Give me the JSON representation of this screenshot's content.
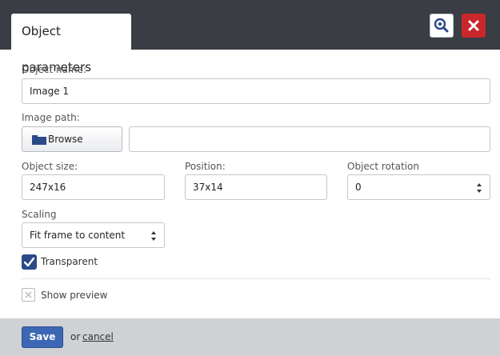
{
  "dialog": {
    "tab_title": "Object parameters",
    "zoom_button": "search-icon",
    "close_button": "close-icon"
  },
  "form": {
    "object_name_label": "Object name:",
    "object_name_value": "Image 1",
    "image_path_label": "Image path:",
    "browse_label": "Browse",
    "image_path_value": "",
    "object_size_label": "Object size:",
    "object_size_value": "247x16",
    "position_label": "Position:",
    "position_value": "37x14",
    "rotation_label": "Object rotation",
    "rotation_value": "0",
    "scaling_label": "Scaling",
    "scaling_value": "Fit frame to content",
    "transparent_label": "Transparent",
    "transparent_checked": true,
    "show_preview_label": "Show preview",
    "show_preview_checked": false
  },
  "footer": {
    "save_label": "Save",
    "or_text": "or",
    "cancel_label": "cancel"
  },
  "colors": {
    "header_bg": "#3a3d43",
    "close_red": "#c9272b",
    "save_blue": "#3d67b4",
    "footer_bg": "#cfd1d5"
  }
}
